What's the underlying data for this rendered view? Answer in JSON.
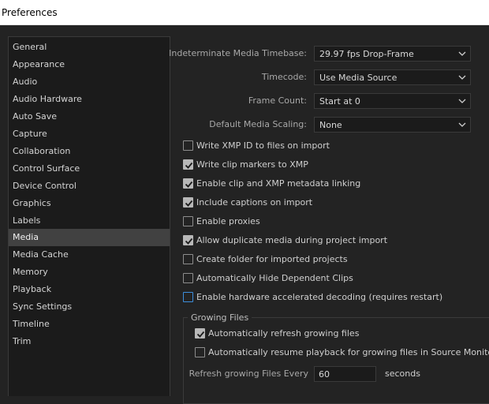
{
  "window": {
    "title": "Preferences"
  },
  "sidebar": {
    "items": [
      {
        "label": "General"
      },
      {
        "label": "Appearance"
      },
      {
        "label": "Audio"
      },
      {
        "label": "Audio Hardware"
      },
      {
        "label": "Auto Save"
      },
      {
        "label": "Capture"
      },
      {
        "label": "Collaboration"
      },
      {
        "label": "Control Surface"
      },
      {
        "label": "Device Control"
      },
      {
        "label": "Graphics"
      },
      {
        "label": "Labels"
      },
      {
        "label": "Media"
      },
      {
        "label": "Media Cache"
      },
      {
        "label": "Memory"
      },
      {
        "label": "Playback"
      },
      {
        "label": "Sync Settings"
      },
      {
        "label": "Timeline"
      },
      {
        "label": "Trim"
      }
    ],
    "selected": "Media"
  },
  "settings": {
    "timebase": {
      "label": "Indeterminate Media Timebase:",
      "value": "29.97 fps Drop-Frame"
    },
    "timecode": {
      "label": "Timecode:",
      "value": "Use Media Source"
    },
    "frame_count": {
      "label": "Frame Count:",
      "value": "Start at 0"
    },
    "scaling": {
      "label": "Default Media Scaling:",
      "value": "None"
    }
  },
  "checkboxes": [
    {
      "label": "Write XMP ID to files on import",
      "checked": false
    },
    {
      "label": "Write clip markers to XMP",
      "checked": true
    },
    {
      "label": "Enable clip and XMP metadata linking",
      "checked": true
    },
    {
      "label": "Include captions on import",
      "checked": true
    },
    {
      "label": "Enable proxies",
      "checked": false
    },
    {
      "label": "Allow duplicate media during project import",
      "checked": true
    },
    {
      "label": "Create folder for imported projects",
      "checked": false
    },
    {
      "label": "Automatically Hide Dependent Clips",
      "checked": false
    },
    {
      "label": "Enable hardware accelerated decoding (requires restart)",
      "checked": false
    }
  ],
  "growing_files": {
    "title": "Growing Files",
    "auto_refresh": {
      "label": "Automatically refresh growing files",
      "checked": true
    },
    "auto_resume": {
      "label": "Automatically resume playback for growing files in Source Monitor",
      "checked": false
    },
    "refresh_label": "Refresh growing Files Every",
    "refresh_value": "60",
    "refresh_unit": "seconds"
  },
  "colors": {
    "background": "#232323",
    "panel": "#1b1b1b",
    "selected_item": "#414141",
    "focus_blue": "#3d8edc"
  }
}
